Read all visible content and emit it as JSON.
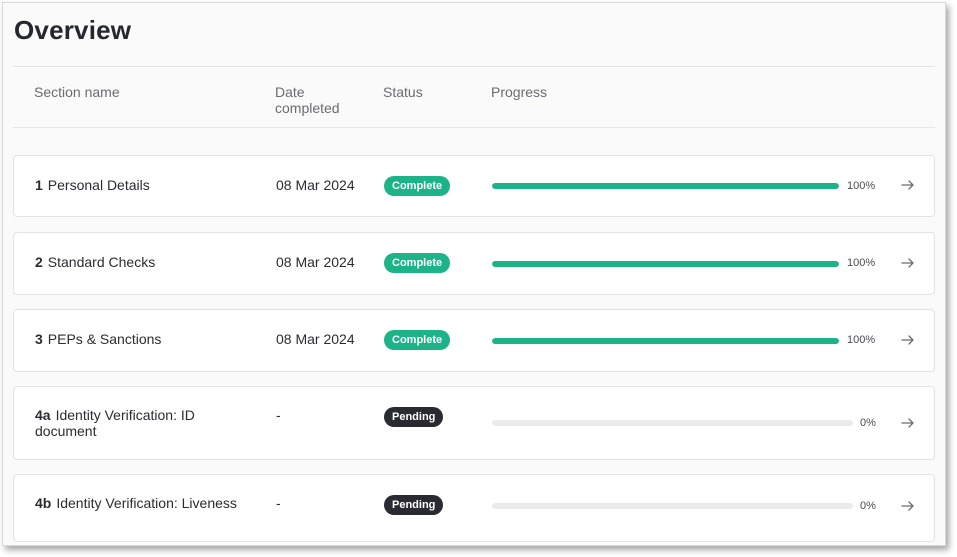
{
  "page": {
    "title": "Overview"
  },
  "columns": {
    "section_name": "Section name",
    "date_completed": "Date completed",
    "status": "Status",
    "progress": "Progress"
  },
  "colors": {
    "complete": "#1db389",
    "pending": "#2a2a33"
  },
  "rows": [
    {
      "number": "1",
      "name": "Personal Details",
      "date": "08 Mar 2024",
      "status": "Complete",
      "progress": 100,
      "progress_label": "100%",
      "icon": "arrow-right-icon"
    },
    {
      "number": "2",
      "name": "Standard Checks",
      "date": "08 Mar 2024",
      "status": "Complete",
      "progress": 100,
      "progress_label": "100%",
      "icon": "arrow-right-icon"
    },
    {
      "number": "3",
      "name": "PEPs & Sanctions",
      "date": "08 Mar 2024",
      "status": "Complete",
      "progress": 100,
      "progress_label": "100%",
      "icon": "arrow-right-icon"
    },
    {
      "number": "4a",
      "name": "Identity Verification: ID document",
      "date": "-",
      "status": "Pending",
      "progress": 0,
      "progress_label": "0%",
      "icon": "arrow-right-icon"
    },
    {
      "number": "4b",
      "name": "Identity Verification: Liveness",
      "date": "-",
      "status": "Pending",
      "progress": 0,
      "progress_label": "0%",
      "icon": "arrow-right-icon"
    }
  ]
}
